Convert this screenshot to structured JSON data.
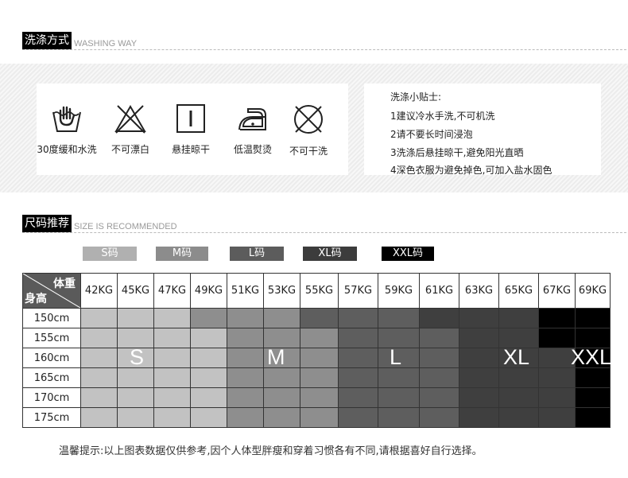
{
  "washing": {
    "title_cn": "洗涤方式",
    "title_en": "WASHING WAY",
    "items": [
      {
        "icon": "hand-wash-icon",
        "label": "30度缓和水洗"
      },
      {
        "icon": "no-bleach-icon",
        "label": "不可漂白"
      },
      {
        "icon": "hang-dry-icon",
        "label": "悬挂晾干"
      },
      {
        "icon": "low-iron-icon",
        "label": "低温熨烫"
      },
      {
        "icon": "no-dry-clean-icon",
        "label": "不可干洗"
      }
    ],
    "tips_title": "洗涤小贴士:",
    "tips": [
      "1建议冷水手洗,不可机洗",
      "2请不要长时间浸泡",
      "3洗涤后悬挂晾干,避免阳光直晒",
      "4深色衣服为避免掉色,可加入盐水固色"
    ]
  },
  "size": {
    "title_cn": "尺码推荐",
    "title_en": "SIZE IS RECOMMENDED",
    "tags": [
      {
        "label": "S码",
        "color": "#b0b0b0"
      },
      {
        "label": "M码",
        "color": "#8c8c8c"
      },
      {
        "label": "L码",
        "color": "#5c5c5c"
      },
      {
        "label": "XL码",
        "color": "#3c3c3c"
      },
      {
        "label": "XXL码",
        "color": "#000000"
      }
    ],
    "corner_weight": "体重",
    "corner_height": "身高",
    "weights": [
      "42KG",
      "45KG",
      "47KG",
      "49KG",
      "51KG",
      "53KG",
      "55KG",
      "57KG",
      "59KG",
      "61KG",
      "63KG",
      "65KG",
      "67KG",
      "69KG"
    ],
    "heights": [
      "150cm",
      "155cm",
      "160cm",
      "165cm",
      "170cm",
      "175cm"
    ],
    "size_labels": [
      "S",
      "M",
      "L",
      "XL",
      "XXL"
    ],
    "colors": {
      "S": "#c2c2c2",
      "M": "#8e8e8e",
      "L": "#5e5e5e",
      "XL": "#3f3f3f",
      "XXL": "#000000"
    },
    "grid": [
      [
        "S",
        "S",
        "S",
        "M",
        "M",
        "M",
        "L",
        "L",
        "L",
        "XL",
        "XL",
        "XL",
        "XXL",
        "XXL"
      ],
      [
        "S",
        "S",
        "S",
        "S",
        "M",
        "M",
        "M",
        "L",
        "L",
        "L",
        "XL",
        "XL",
        "XXL",
        "XXL"
      ],
      [
        "S",
        "S",
        "S",
        "S",
        "M",
        "M",
        "M",
        "L",
        "L",
        "L",
        "XL",
        "XL",
        "XL",
        "XXL"
      ],
      [
        "S",
        "S",
        "S",
        "S",
        "M",
        "M",
        "M",
        "L",
        "L",
        "L",
        "XL",
        "XL",
        "XL",
        "XXL"
      ],
      [
        "S",
        "S",
        "S",
        "S",
        "M",
        "M",
        "M",
        "L",
        "L",
        "L",
        "XL",
        "XL",
        "XL",
        "XXL"
      ],
      [
        "S",
        "S",
        "S",
        "S",
        "M",
        "M",
        "M",
        "L",
        "L",
        "L",
        "XL",
        "XL",
        "XL",
        "XXL"
      ]
    ],
    "footnote": "温馨提示:以上图表数据仅供参考,因个人体型胖瘦和穿着习惯各有不同,请根据喜好自行选择。"
  }
}
